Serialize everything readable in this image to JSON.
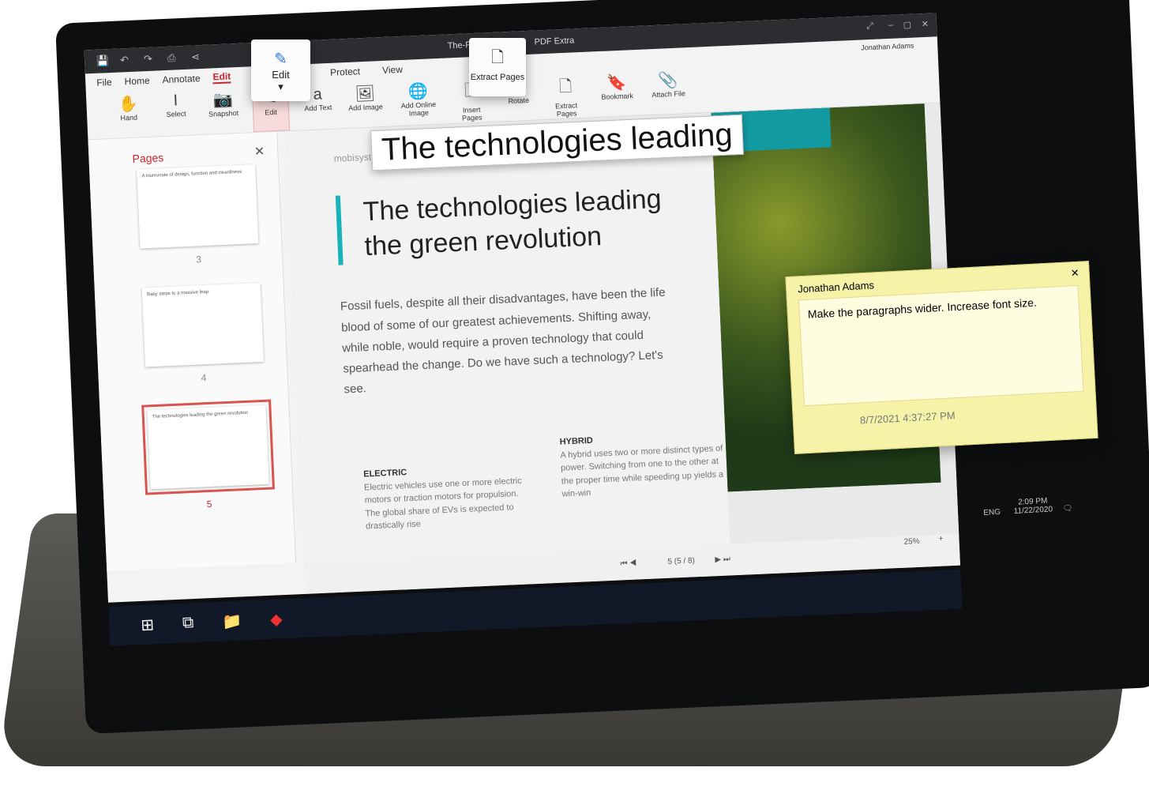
{
  "app": {
    "title_left": "The-Fut",
    "title_right": "PDF Extra",
    "user": "Jonathan Adams"
  },
  "menu": [
    "File",
    "Home",
    "Annotate",
    "Edit",
    "Protect",
    "View"
  ],
  "tools": [
    "Hand",
    "Select",
    "Snapshot",
    "Edit",
    "Add Text",
    "Add Image",
    "Add Online Image",
    "Insert Pages",
    "Rotate",
    "Extract Pages",
    "Bookmark",
    "Attach File"
  ],
  "popups": {
    "edit": "Edit",
    "extract": "Extract Pages"
  },
  "sidebar": {
    "title": "Pages",
    "thumbs": [
      {
        "text": "A triumvirate of design, function and cleanliness",
        "num": "3"
      },
      {
        "text": "Baby steps to a massive leap",
        "num": "4"
      },
      {
        "text": "The technologies leading the green revolution",
        "num": "5"
      }
    ]
  },
  "document": {
    "brand": "mobisystems",
    "heading": "The technologies leading the green revolution",
    "floating": "The technologies leading",
    "paragraph": "Fossil fuels, despite all their disadvantages, have been the life blood of some of our greatest achievements. Shifting away, while noble, would require a proven technology that could spearhead the change. Do we have such a technology? Let's see.",
    "electric": {
      "title": "ELECTRIC",
      "text": "Electric vehicles use one or more electric motors or traction motors for propulsion. The global share of EVs is expected to drastically rise"
    },
    "hybrid": {
      "title": "HYBRID",
      "text": "A hybrid uses two or more distinct types of power. Switching from one to the other at the proper time while speeding up yields a win-win"
    }
  },
  "comment": {
    "author": "Jonathan Adams",
    "text": "Make the paragraphs wider. Increase font size.",
    "date": "8/7/2021 4:37:27 PM"
  },
  "status": {
    "page": "5 (5 / 8)",
    "zoom": "25%"
  },
  "tray": {
    "lang": "ENG",
    "time": "2:09 PM",
    "date": "11/22/2020"
  },
  "colors": {
    "accent": "#c4262e",
    "teal": "#17b3b9",
    "note": "#f6f3a9"
  }
}
